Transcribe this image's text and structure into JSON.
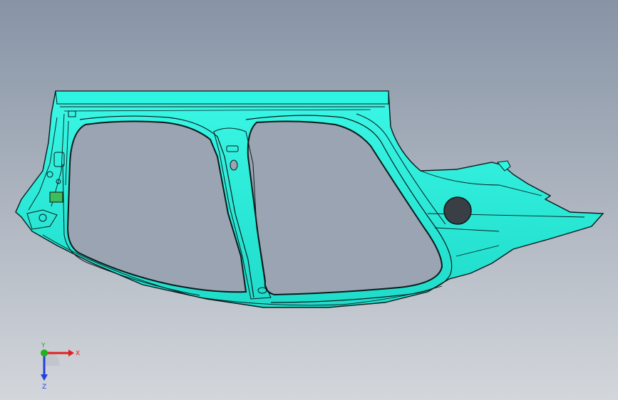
{
  "viewport": {
    "background_top": "#8794a6",
    "background_bottom": "#d3d6db"
  },
  "model": {
    "fill_color": "#27f2df",
    "edge_color": "#0a1a1a",
    "hole_color": "#3a3f45"
  },
  "triad": {
    "x_label": "X",
    "y_label": "Y",
    "z_label": "Z",
    "x_color": "#e02020",
    "y_color": "#20b020",
    "z_color": "#2040e0"
  }
}
